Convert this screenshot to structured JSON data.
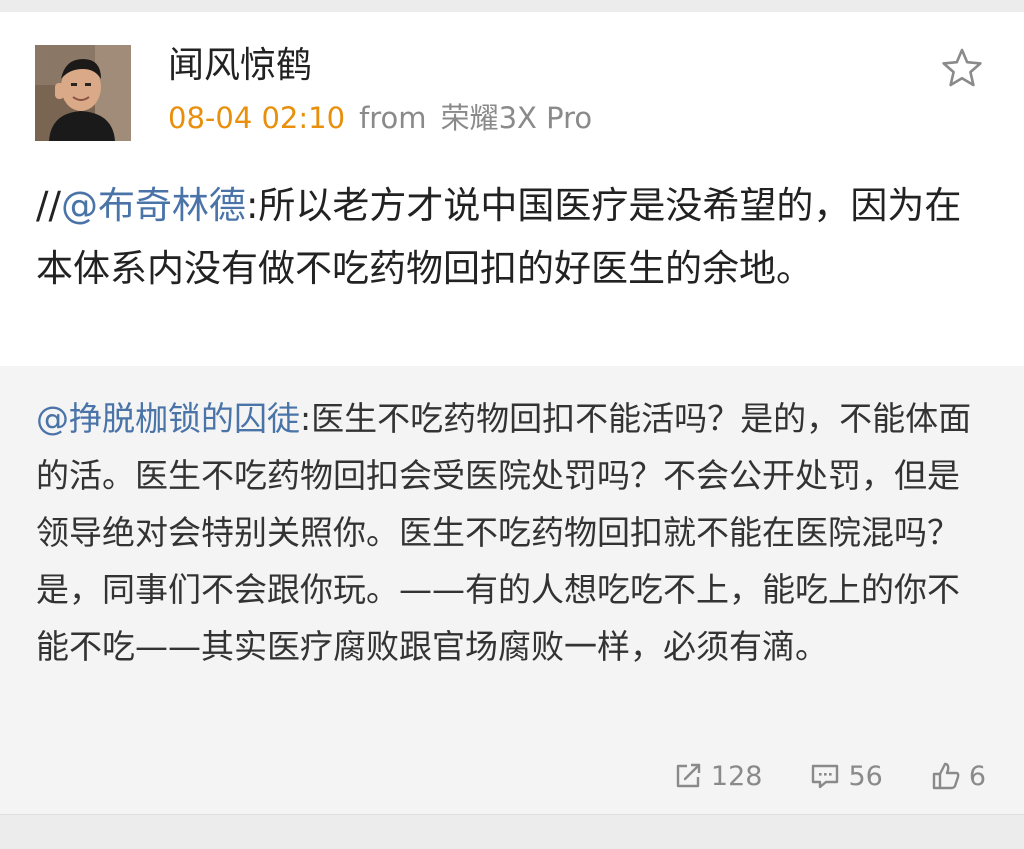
{
  "post": {
    "author": "闻风惊鹤",
    "time": "08-04 02:10",
    "from_label": "from",
    "device": "荣耀3X Pro",
    "text_prefix": "//",
    "mention": "@布奇林德",
    "text_body": ":所以老方才说中国医疗是没希望的，因为在本体系内没有做不吃药物回扣的好医生的余地。"
  },
  "repost": {
    "mention": "@挣脱枷锁的囚徒",
    "text_body": ":医生不吃药物回扣不能活吗？是的，不能体面的活。医生不吃药物回扣会受医院处罚吗？不会公开处罚，但是领导绝对会特别关照你。医生不吃药物回扣就不能在医院混吗？是，同事们不会跟你玩。——有的人想吃吃不上，能吃上的你不能不吃——其实医疗腐败跟官场腐败一样，必须有滴。",
    "repost_count": "128",
    "comment_count": "56",
    "like_count": "6"
  },
  "icons": {
    "favorite": "star-icon",
    "repost": "repost-icon",
    "comment": "comment-icon",
    "like": "thumbs-up-icon"
  },
  "colors": {
    "time": "#e8900c",
    "mention": "#4a74a8",
    "repost_bg": "#f4f4f4"
  }
}
